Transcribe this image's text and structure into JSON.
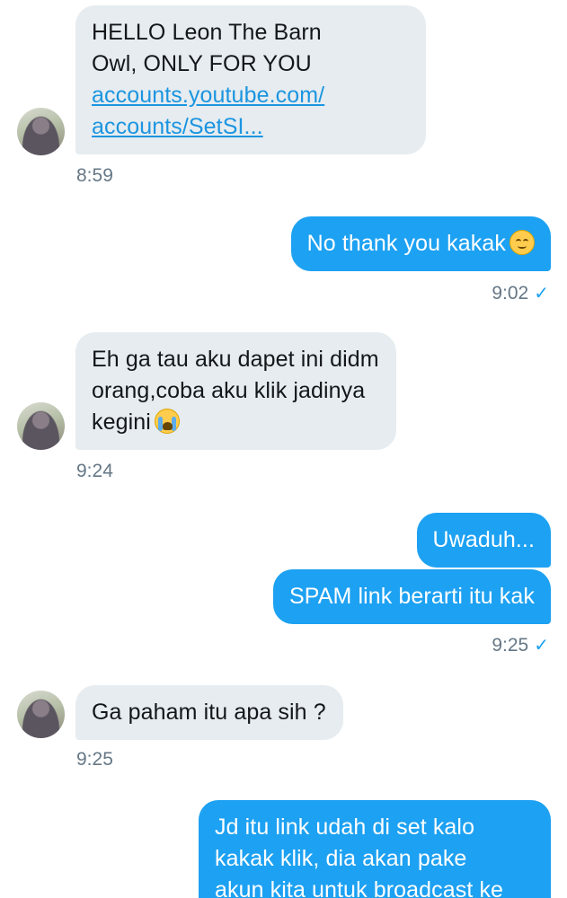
{
  "messages": [
    {
      "direction": "in",
      "text_line1": "HELLO Leon The Barn",
      "text_line2": "Owl, ONLY FOR YOU",
      "link_line1": "accounts.youtube.com/",
      "link_line2": "accounts/SetSI...",
      "time": "8:59"
    },
    {
      "direction": "out",
      "text": "No thank you kakak",
      "emoji": "smiling-face-emoji",
      "time": "9:02",
      "status": "✓"
    },
    {
      "direction": "in",
      "text_line1": "Eh ga tau aku dapet ini didm",
      "text_line2": "orang,coba aku klik jadinya",
      "text_line3": "kegini",
      "emoji": "crying-face-emoji",
      "time": "9:24"
    },
    {
      "direction": "out",
      "text": "Uwaduh..."
    },
    {
      "direction": "out",
      "text": "SPAM link berarti itu kak",
      "time": "9:25",
      "status": "✓"
    },
    {
      "direction": "in",
      "text": "Ga paham itu apa sih ?",
      "time": "9:25"
    },
    {
      "direction": "out",
      "text_line1": "Jd itu link udah di set kalo",
      "text_line2": "kakak klik, dia akan pake",
      "text_line3": "akun kita untuk broadcast ke"
    }
  ],
  "colors": {
    "incoming_bubble": "#e6ecf0",
    "outgoing_bubble": "#1da1f2",
    "link": "#1b95e0",
    "timestamp": "#657786"
  }
}
